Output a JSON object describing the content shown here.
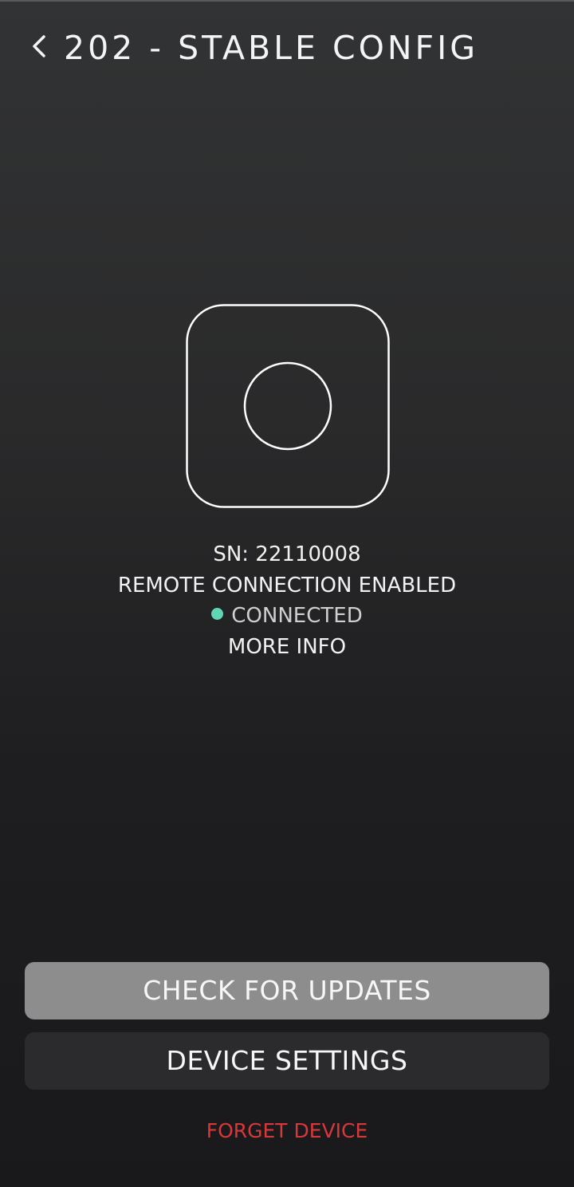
{
  "header": {
    "back_icon": "chevron-left-icon",
    "title": "202 - STABLE CONFIG"
  },
  "device": {
    "illustration_icon": "device-square-icon",
    "serial_number": "SN: 22110008",
    "remote_status": "REMOTE CONNECTION ENABLED",
    "connection_status": "CONNECTED",
    "connection_status_color": "#5fd6b6",
    "more_info_label": "MORE INFO"
  },
  "actions": {
    "check_updates_label": "CHECK FOR UPDATES",
    "device_settings_label": "DEVICE SETTINGS",
    "forget_device_label": "FORGET DEVICE",
    "forget_device_color": "#d9383a"
  }
}
